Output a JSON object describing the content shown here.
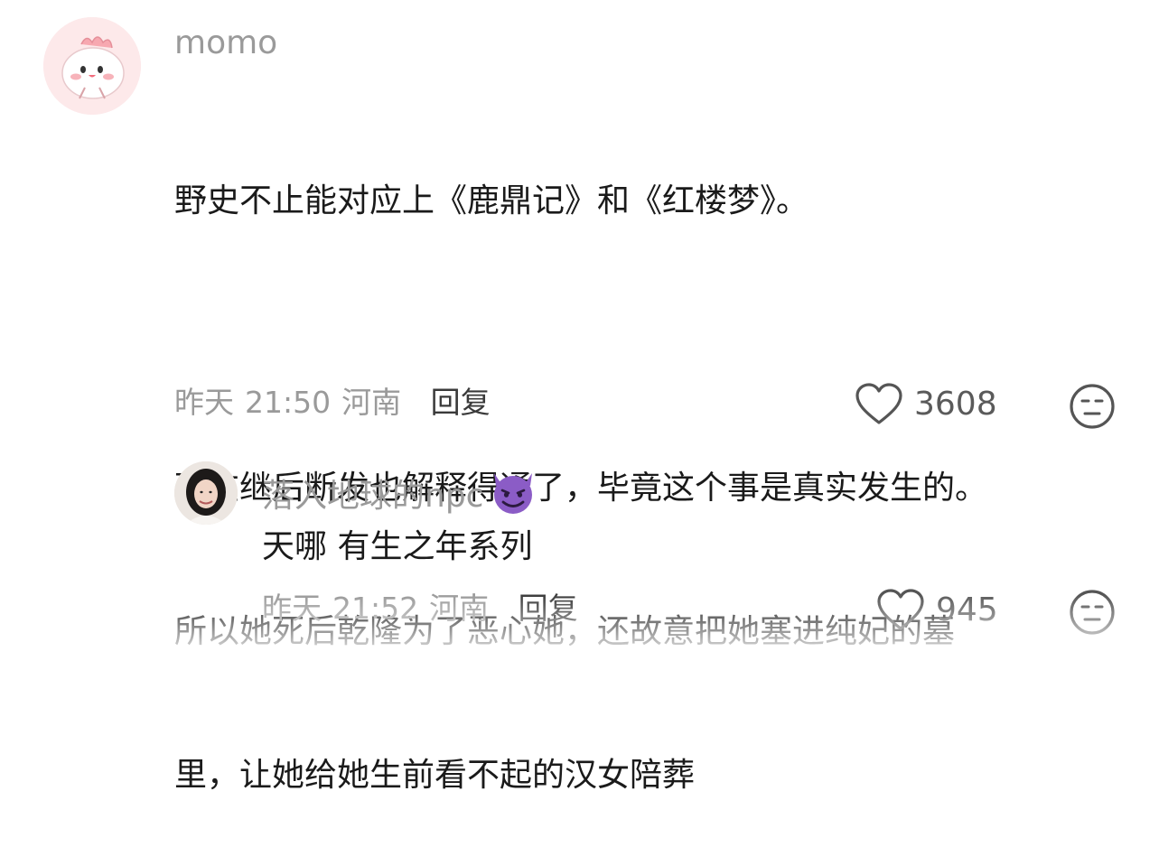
{
  "main_comment": {
    "username": "momo",
    "lines": [
      "野史不止能对应上《鹿鼎记》和《红楼梦》。",
      "",
      "现在继后断发也解释得通了，毕竟这个事是真实发生的。",
      "所以她死后乾隆为了恶心她，还故意把她塞进纯妃的墓",
      "里，让她给她生前看不起的汉女陪葬"
    ],
    "date": "昨天",
    "time": "21:50",
    "location": "河南",
    "reply_label": "回复",
    "like_count": "3608",
    "icons": {
      "like": "heart-icon",
      "dislike": "unhappy-face-icon"
    }
  },
  "reply_comment": {
    "username": "落入地球的npc",
    "badge": "😈",
    "text": "天哪 有生之年系列",
    "date": "昨天",
    "time": "21:52",
    "location": "河南",
    "reply_label": "回复",
    "like_count": "945",
    "icons": {
      "like": "heart-icon",
      "dislike": "unhappy-face-icon"
    }
  },
  "colors": {
    "text": "#1a1a1a",
    "meta": "#9a9a9a",
    "avatar_bg": "#fbe6e8"
  }
}
